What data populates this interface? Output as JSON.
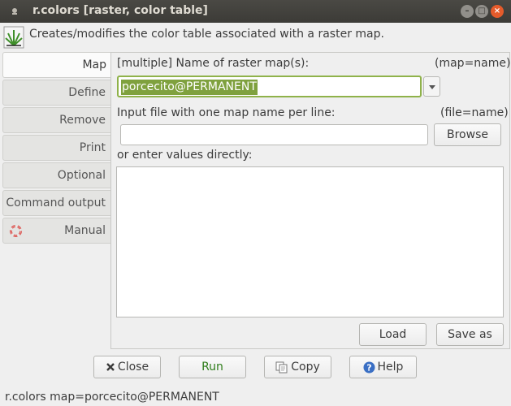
{
  "window": {
    "title": "r.colors [raster, color table]"
  },
  "description": "Creates/modifies the color table associated with a raster map.",
  "tabs": [
    {
      "label": "Map",
      "active": true
    },
    {
      "label": "Define"
    },
    {
      "label": "Remove"
    },
    {
      "label": "Print"
    },
    {
      "label": "Optional"
    },
    {
      "label": "Command output"
    },
    {
      "label": "Manual",
      "icon": "lifebuoy-icon"
    }
  ],
  "map_panel": {
    "raster_label": "[multiple] Name of raster map(s):",
    "raster_param": "(map=name)",
    "raster_value": "porcecito@PERMANENT",
    "file_label": "Input file with one map name per line:",
    "file_param": "(file=name)",
    "file_value": "",
    "browse_label": "Browse",
    "direct_label": "or enter values directly:",
    "direct_value": "",
    "load_label": "Load",
    "saveas_label": "Save as"
  },
  "buttons": {
    "close": "Close",
    "run": "Run",
    "copy": "Copy",
    "help": "Help"
  },
  "status": "r.colors map=porcecito@PERMANENT",
  "colors": {
    "titlebar": "#3c3b37",
    "close_window": "#e55b2b",
    "selection": "#7fa13e",
    "focus_border": "#8fb24a",
    "run_text": "#2e7d1a"
  }
}
